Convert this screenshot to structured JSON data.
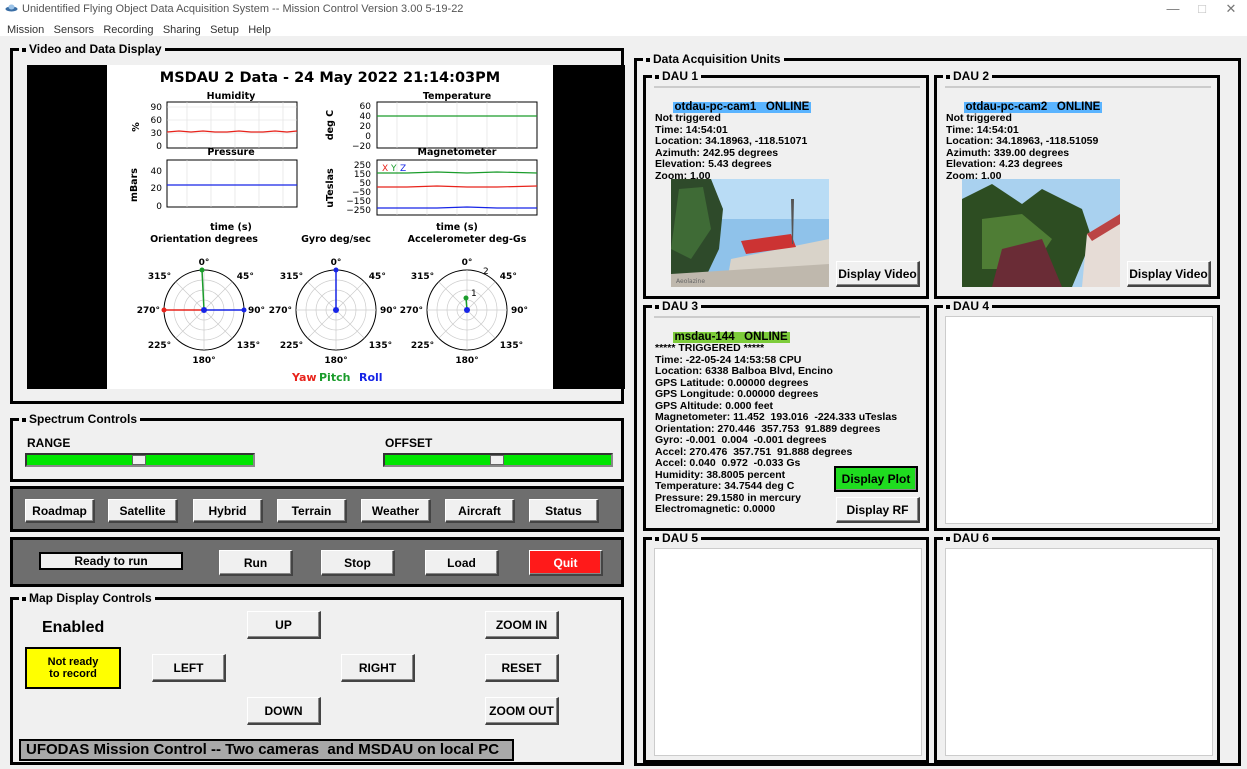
{
  "window": {
    "title": "Unidentified Flying Object Data Acquisition System -- Mission Control   Version 3.00  5-19-22"
  },
  "menu": [
    "Mission",
    "Sensors",
    "Recording",
    "Sharing",
    "Setup",
    "Help"
  ],
  "video": {
    "legend": "Video and Data Display",
    "plot_title": "MSDAU 2 Data - 24 May 2022 21:14:03PM",
    "humidity": {
      "title": "Humidity",
      "ylabel": "%",
      "yticks": [
        "90",
        "60",
        "30",
        "0"
      ]
    },
    "temperature": {
      "title": "Temperature",
      "ylabel": "deg C",
      "yticks": [
        "60",
        "40",
        "20",
        "0",
        "−20"
      ]
    },
    "pressure": {
      "title": "Pressure",
      "ylabel": "mBars",
      "yticks": [
        "40",
        "20",
        "0"
      ],
      "xlabel": "time (s)"
    },
    "magnetometer": {
      "title": "Magnetometer",
      "ylabel": "uTeslas",
      "yticks": [
        "250",
        "150",
        "50",
        "−50",
        "−150",
        "−250"
      ],
      "xlabel": "time (s)",
      "legend": [
        "X",
        "Y",
        "Z"
      ]
    },
    "polar_titles": [
      "Orientation degrees",
      "Gyro deg/sec",
      "Accelerometer deg-Gs"
    ],
    "angle_labels": {
      "top": "0°",
      "tr": "45°",
      "right": "90°",
      "br": "135°",
      "bottom": "180°",
      "bl": "225°",
      "left": "270°",
      "tl": "315°"
    },
    "accel_rings": [
      "1",
      "2"
    ],
    "legend_items": [
      "Yaw",
      "Pitch",
      "Roll"
    ],
    "colors": {
      "red": "#e8231b",
      "green": "#1a9c2b",
      "blue": "#1624e6"
    }
  },
  "spectrum": {
    "legend": "Spectrum Controls",
    "range_label": "RANGE",
    "offset_label": "OFFSET"
  },
  "map_buttons": [
    "Roadmap",
    "Satellite",
    "Hybrid",
    "Terrain",
    "Weather",
    "Aircraft",
    "Status"
  ],
  "run_controls": {
    "status": "Ready to run",
    "run": "Run",
    "stop": "Stop",
    "load": "Load",
    "quit": "Quit"
  },
  "map_controls": {
    "legend": "Map Display Controls",
    "enabled": "Enabled",
    "record_status": "Not ready\nto record",
    "up": "UP",
    "down": "DOWN",
    "left": "LEFT",
    "right": "RIGHT",
    "zoom_in": "ZOOM IN",
    "reset": "RESET",
    "zoom_out": "ZOOM OUT",
    "footer": "UFODAS Mission Control -- Two cameras  and MSDAU on local PC"
  },
  "dau_panel": {
    "legend": "Data Acquisition Units",
    "units": [
      {
        "legend": "DAU 1",
        "name": "otdau-pc-cam1   ONLINE",
        "lines": "Not triggered\nTime: 14:54:01\nLocation: 34.18963, -118.51071\nAzimuth: 242.95 degrees\nElevation: 5.43 degrees\nZoom: 1.00",
        "button": "Display Video"
      },
      {
        "legend": "DAU 2",
        "name": "otdau-pc-cam2   ONLINE",
        "lines": "Not triggered\nTime: 14:54:01\nLocation: 34.18963, -118.51059\nAzimuth: 339.00 degrees\nElevation: 4.23 degrees\nZoom: 1.00",
        "button": "Display Video"
      },
      {
        "legend": "DAU 3",
        "name": "msdau-144   ONLINE",
        "lines": "***** TRIGGERED *****\nTime: -22-05-24 14:53:58 CPU\nLocation: 6338 Balboa Blvd, Encino\nGPS Latitude: 0.00000 degrees\nGPS Longitude: 0.00000 degrees\nGPS Altitude: 0.000 feet\nMagnetometer: 11.452  193.016  -224.333 uTeslas\nOrientation: 270.446  357.753  91.889 degrees\nGyro: -0.001  0.004  -0.001 degrees\nAccel: 270.476  357.751  91.888 degrees\nAccel: 0.040  0.972  -0.033 Gs\nHumidity: 38.8005 percent\nTemperature: 34.7544 deg C\nPressure: 29.1580 in mercury\nElectromagnetic: 0.0000",
        "button_plot": "Display Plot",
        "button_rf": "Display RF"
      },
      {
        "legend": "DAU 4"
      },
      {
        "legend": "DAU 5"
      },
      {
        "legend": "DAU 6"
      }
    ],
    "cam_overlay_1": "Aeolazine"
  }
}
